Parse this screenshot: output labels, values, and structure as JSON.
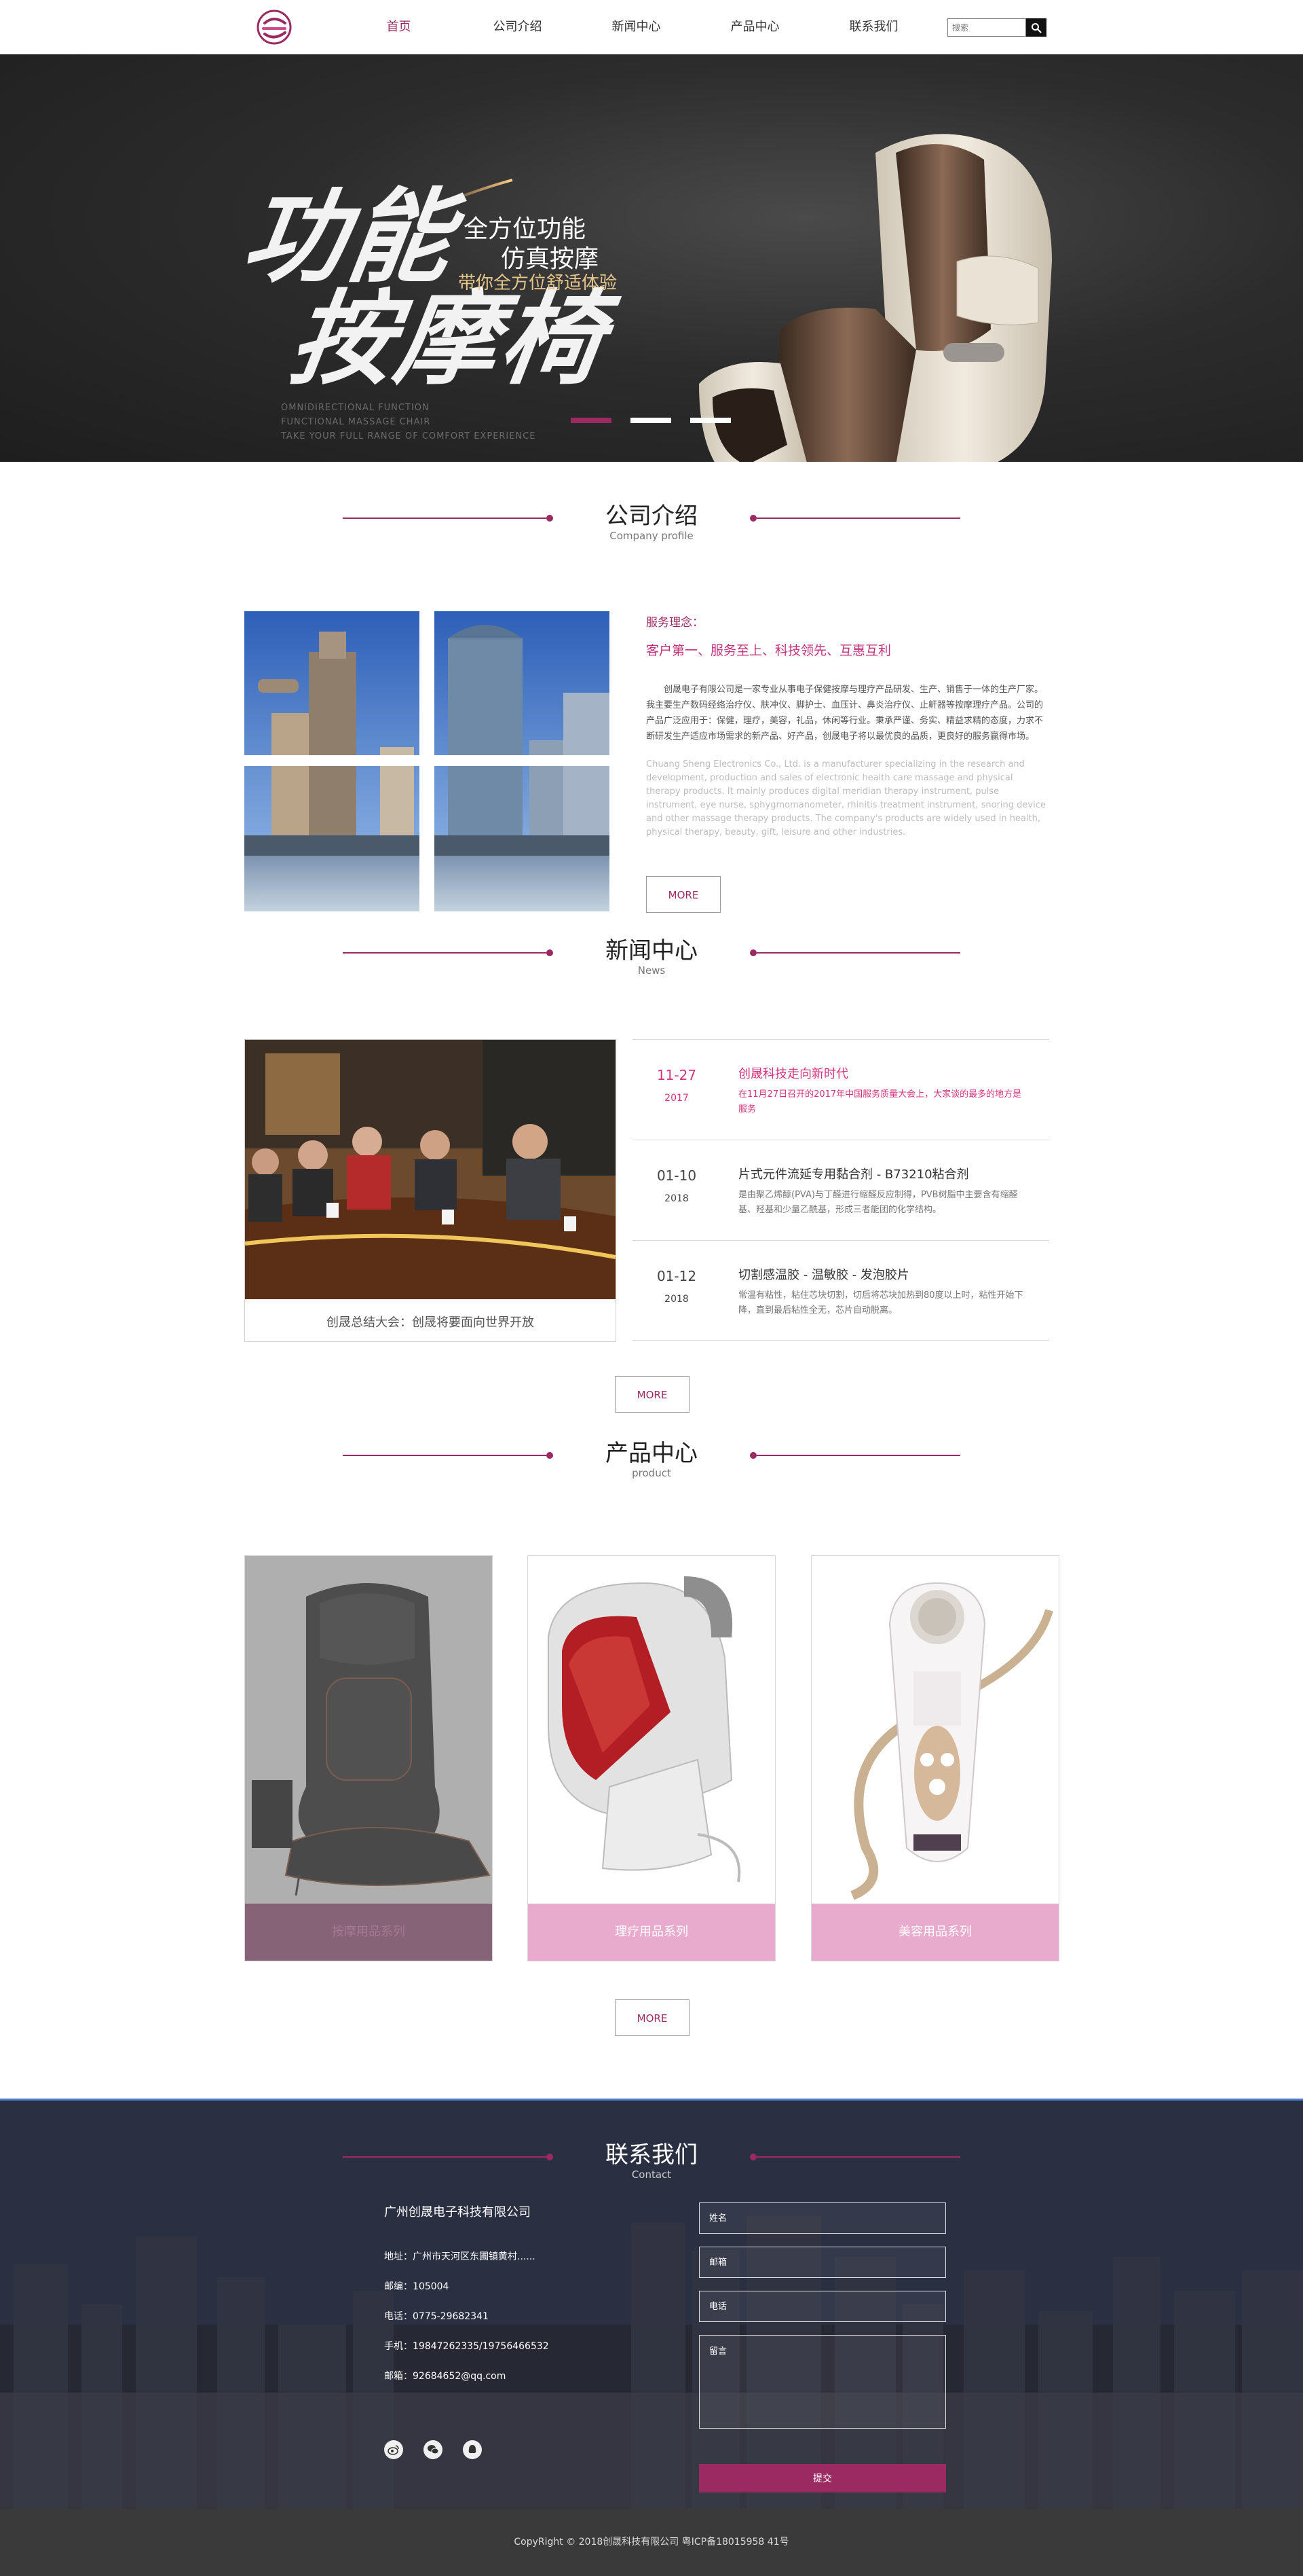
{
  "header": {
    "nav": [
      {
        "label": "首页",
        "active": true
      },
      {
        "label": "公司介绍",
        "active": false
      },
      {
        "label": "新闻中心",
        "active": false
      },
      {
        "label": "产品中心",
        "active": false
      },
      {
        "label": "联系我们",
        "active": false
      }
    ],
    "search_placeholder": "搜索",
    "brand_color": "#9b2a63"
  },
  "banner": {
    "title_line1": "功能",
    "title_line2": "按摩椅",
    "sub1": "全方位功能",
    "sub2": "仿真按摩",
    "sub3": "带你全方位舒适体验",
    "en_line1": "OMNIDIRECTIONAL FUNCTION",
    "en_line2": "FUNCTIONAL MASSAGE CHAIR",
    "en_line3": "TAKE YOUR FULL RANGE OF COMFORT EXPERIENCE",
    "active_slide": 1,
    "slides": 3
  },
  "about": {
    "title": "公司介绍",
    "subtitle": "Company profile",
    "label": "服务理念：",
    "motto": "客户第一、服务至上、科技领先、互惠互利",
    "text_cn": "创晟电子有限公司是一家专业从事电子保健按摩与理疗产品研发、生产、销售于一体的生产厂家。我主要生产数码经络治疗仪、肤冲仪、脚护士、血压计、鼻炎治疗仪、止鼾器等按摩理疗产品。公司的产品广泛应用于：保健，理疗，美容，礼品，休闲等行业。秉承严谨、务实、精益求精的态度，力求不断研发生产适应市场需求的新产品、好产品，创晟电子将以最优良的品质，更良好的服务赢得市场。",
    "text_en": "Chuang Sheng Electronics Co., Ltd. is a manufacturer specializing in the research and development, production and sales of electronic health care massage and physical therapy products. It mainly produces digital meridian therapy instrument, pulse instrument, eye nurse, sphygmomanometer, rhinitis treatment instrument, snoring device and other massage therapy products. The company's products are widely used in health, physical therapy, beauty, gift, leisure and other industries.",
    "more": "MORE"
  },
  "news": {
    "title": "新闻中心",
    "subtitle": "News",
    "caption": "创晟总结大会：创晟将要面向世界开放",
    "items": [
      {
        "md": "11-27",
        "year": "2017",
        "title": "创晟科技走向新时代",
        "desc": "在11月27日召开的2017年中国服务质量大会上，大家谈的最多的地方是服务"
      },
      {
        "md": "01-10",
        "year": "2018",
        "title": "片式元件流延专用黏合剂 - B73210粘合剂",
        "desc": "是由聚乙烯醇(PVA)与丁醛进行缩醛反应制得，PVB树脂中主要含有缩醛基、羟基和少量乙酰基，形成三者能团的化学结构。"
      },
      {
        "md": "01-12",
        "year": "2018",
        "title": "切割感温胶 - 温敏胶 - 发泡胶片",
        "desc": "常温有粘性，粘住芯块切割，切后将芯块加热到80度以上时，粘性开始下降，直到最后粘性全无，芯片自动脱离。"
      }
    ],
    "more": "MORE"
  },
  "products": {
    "title": "产品中心",
    "subtitle": "product",
    "items": [
      {
        "label": "按摩用品系列",
        "icon": "massage-cushion"
      },
      {
        "label": "理疗用品系列",
        "icon": "infrared-lamp"
      },
      {
        "label": "美容用品系列",
        "icon": "beauty-device"
      }
    ],
    "more": "MORE"
  },
  "contact": {
    "title": "联系我们",
    "subtitle": "Contact",
    "company": "广州创晟电子科技有限公司",
    "address": "地址：广州市天河区东圃镇黄村......",
    "postcode": "邮编：105004",
    "phone": "电话：0775-29682341",
    "mobile": "手机：19847262335/19756466532",
    "email": "邮箱：92684652@qq.com",
    "form": {
      "name": "姓名",
      "email": "邮箱",
      "phone": "电话",
      "message": "留言",
      "submit": "提交"
    }
  },
  "footer": {
    "copyright": "CopyRight © 2018创晟科技有限公司 粤ICP备18015958 41号"
  }
}
